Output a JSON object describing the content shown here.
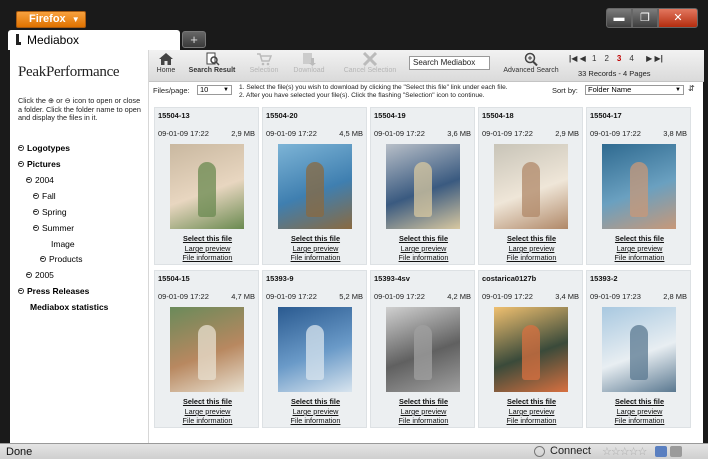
{
  "browser": {
    "menu_button": "Firefox",
    "tab_title": "Mediabox",
    "new_tab": "+",
    "status": "Done",
    "connect": "Connect",
    "stars": "☆☆☆☆☆",
    "window": {
      "minimize": "▬",
      "maximize": "❐",
      "close": "✕"
    }
  },
  "sidebar": {
    "logo": "PeakPerformance",
    "instructions": "Click the ⊕ or ⊖ icon to open or close a folder. Click the folder name to open and display the files in it.",
    "tree": [
      {
        "label": "Logotypes",
        "icon": "plus"
      },
      {
        "label": "Pictures",
        "icon": "minus"
      },
      {
        "label": "2004",
        "icon": "minus"
      },
      {
        "label": "Fall",
        "icon": "plus"
      },
      {
        "label": "Spring",
        "icon": "plus"
      },
      {
        "label": "Summer",
        "icon": "minus"
      },
      {
        "label": "Image",
        "icon": ""
      },
      {
        "label": "Products",
        "icon": "plus"
      },
      {
        "label": "2005",
        "icon": "plus"
      },
      {
        "label": "Press Releases",
        "icon": "plus"
      },
      {
        "label": "Mediabox statistics",
        "icon": ""
      }
    ]
  },
  "toolbar": {
    "home": "Home",
    "search_result": "Search Result",
    "selection": "Selection",
    "download": "Download",
    "cancel_selection": "Cancel Selection",
    "search_value": "Search Mediabox",
    "advanced_search": "Advanced Search",
    "pages": [
      "1",
      "2",
      "3",
      "4"
    ],
    "current_page": "3",
    "record_count": "33 Records - 4 Pages"
  },
  "options": {
    "files_per_page_label": "Files/page:",
    "files_per_page_value": "10",
    "step1": "1. Select the file(s) you wish to download by clicking the \"Select this file\" link under each file.",
    "step2": "2. After you have selected your file(s). Click the flashing \"Selection\" icon to continue.",
    "sort_label": "Sort by:",
    "sort_value": "Folder Name"
  },
  "links": {
    "select": "Select this file",
    "preview": "Large preview",
    "info": "File information"
  },
  "cards": [
    {
      "id": "15504-13",
      "date": "09-01-09 17:22",
      "size": "2,9 MB",
      "palette": [
        "#c9b8a0",
        "#e8d6c0",
        "#6a8a50"
      ]
    },
    {
      "id": "15504-20",
      "date": "09-01-09 17:22",
      "size": "4,5 MB",
      "palette": [
        "#7db4d6",
        "#3f7fb0",
        "#8a6a40"
      ]
    },
    {
      "id": "15504-19",
      "date": "09-01-09 17:22",
      "size": "3,6 MB",
      "palette": [
        "#b8bfc8",
        "#3a5a80",
        "#d8c8a0"
      ]
    },
    {
      "id": "15504-18",
      "date": "09-01-09 17:22",
      "size": "2,9 MB",
      "palette": [
        "#c8c4b8",
        "#efe6d8",
        "#b08868"
      ]
    },
    {
      "id": "15504-17",
      "date": "09-01-09 17:22",
      "size": "3,8 MB",
      "palette": [
        "#2f6a90",
        "#6aa0c0",
        "#c89878"
      ]
    },
    {
      "id": "15504-15",
      "date": "09-01-09 17:22",
      "size": "4,7 MB",
      "palette": [
        "#6a8a5a",
        "#b88860",
        "#e8e0d0"
      ]
    },
    {
      "id": "15393-9",
      "date": "09-01-09 17:22",
      "size": "5,2 MB",
      "palette": [
        "#2a5a90",
        "#6a9ac8",
        "#d8e4ee"
      ]
    },
    {
      "id": "15393-4sv",
      "date": "09-01-09 17:22",
      "size": "4,2 MB",
      "palette": [
        "#d0d0d0",
        "#606060",
        "#a0a0a0"
      ]
    },
    {
      "id": "costarica0127b",
      "date": "09-01-09 17:22",
      "size": "3,4 MB",
      "palette": [
        "#f0c070",
        "#3a4a3a",
        "#d87040"
      ]
    },
    {
      "id": "15393-2",
      "date": "09-01-09 17:23",
      "size": "2,8 MB",
      "palette": [
        "#a8c8e0",
        "#e8eef2",
        "#5a7890"
      ]
    }
  ]
}
